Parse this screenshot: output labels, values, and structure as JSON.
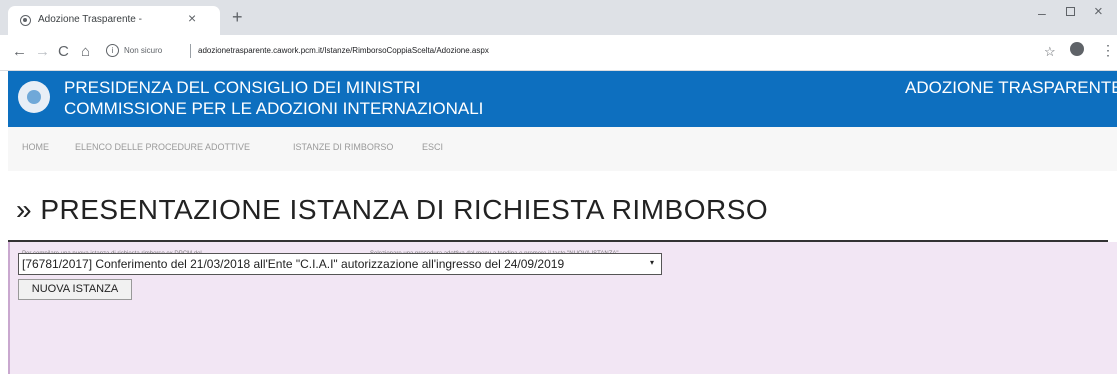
{
  "browser": {
    "tab_title": "Adozione Trasparente -",
    "tab_close": "×",
    "new_tab": "+",
    "nav": {
      "back": "←",
      "forward": "→",
      "reload": "C",
      "home": "⌂"
    },
    "address": {
      "security_label": "Non sicuro",
      "url": "adozionetrasparente.cawork.pcm.it/Istanze/RimborsoCoppiaScelta/Adozione.aspx"
    },
    "window": {
      "minimize": "–",
      "close": "×"
    },
    "star": "☆",
    "menu": "⋮"
  },
  "header": {
    "line1": "PRESIDENZA DEL CONSIGLIO DEI MINISTRI",
    "line2": "COMMISSIONE PER LE ADOZIONI INTERNAZIONALI",
    "right": "ADOZIONE TRASPARENTE",
    "color": "#0d6fbf"
  },
  "nav": {
    "items": [
      "HOME",
      "ELENCO DELLE PROCEDURE ADOTTIVE",
      "ISTANZE DI RIMBORSO",
      "ESCI"
    ]
  },
  "page": {
    "title": "» PRESENTAZIONE ISTANZA DI RICHIESTA RIMBORSO"
  },
  "form": {
    "info_left": "Per compilare una nuova istanza di richiesta rimborso ex DPCM del",
    "info_right": "Selezionare una procedura adottiva dal menu a tendina e premere il tasto \"NUOVA ISTANZA\"",
    "selected_option": "[76781/2017] Conferimento del 21/03/2018 all'Ente \"C.I.A.I\" autorizzazione all'ingresso del 24/09/2019",
    "select_arrow": "▾",
    "button_label": "NUOVA ISTANZA",
    "panel_color": "#f2e6f4"
  }
}
